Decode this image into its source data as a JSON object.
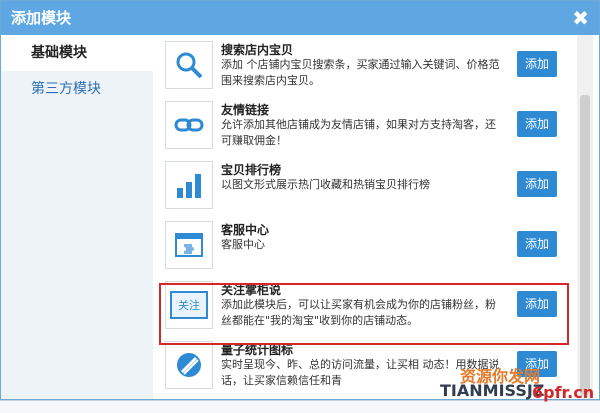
{
  "dialog": {
    "title": "添加模块",
    "close_glyph": "✖"
  },
  "sidebar": {
    "items": [
      {
        "label": "基础模块"
      },
      {
        "label": "第三方模块"
      }
    ]
  },
  "modules": [
    {
      "title": "搜索店内宝贝",
      "desc": "添加 个店铺内宝贝搜索条，买家通过输入关键词、价格范围来搜索店内宝贝。",
      "button": "添加",
      "icon": "search-icon"
    },
    {
      "title": "友情链接",
      "desc": "允许添加其他店铺成为友情店铺，如果对方支持淘客，还可赚取佣金！",
      "button": "添加",
      "icon": "link-icon"
    },
    {
      "title": "宝贝排行榜",
      "desc": "以图文形式展示热门收藏和热销宝贝排行榜",
      "button": "添加",
      "icon": "bar-chart-icon"
    },
    {
      "title": "客服中心",
      "desc": "客服中心",
      "button": "添加",
      "icon": "puzzle-window-icon"
    },
    {
      "title": "关注掌柜说",
      "desc": "添加此模块后，可以让买家有机会成为你的店铺粉丝，粉丝都能在\"我的淘宝\"收到你的店铺动态。",
      "button": "添加",
      "icon": "follow-icon",
      "icon_text": "关注"
    },
    {
      "title": "量子统计图标",
      "desc": "实时呈现今、昨、总的访问流量，让买相 动态！用数据说话，让买家信赖信任和青",
      "button": "添加",
      "icon": "stats-icon"
    }
  ],
  "watermark": {
    "line1": "资源你发网",
    "line2": "TIANMISSJZ",
    "line3": "6pfr.cn"
  },
  "colors": {
    "title_bar": "#5fa7e3",
    "button": "#2d8ad3",
    "highlight": "#d62728"
  }
}
